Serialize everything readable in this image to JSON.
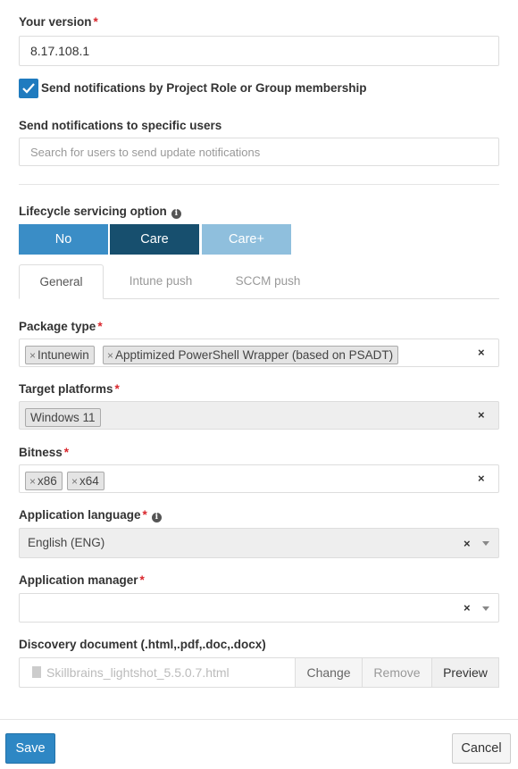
{
  "version": {
    "label": "Your version",
    "value": "8.17.108.1"
  },
  "notify_roles": {
    "label": "Send notifications by Project Role or Group membership",
    "checked": true
  },
  "notify_users": {
    "label": "Send notifications to specific users",
    "placeholder": "Search for users to send update notifications"
  },
  "lifecycle": {
    "label": "Lifecycle servicing option",
    "options": [
      "No",
      "Care",
      "Care+"
    ],
    "selected": "Care",
    "colors": {
      "no": "#3a8dc6",
      "care": "#174f6e",
      "care_plus": "#8fbfdd"
    }
  },
  "tabs": [
    "General",
    "Intune push",
    "SCCM push"
  ],
  "active_tab": "General",
  "package_type": {
    "label": "Package type",
    "tags": [
      "Intunewin",
      "Apptimized PowerShell Wrapper (based on PSADT)"
    ]
  },
  "target_platforms": {
    "label": "Target platforms",
    "tags": [
      "Windows 11"
    ]
  },
  "bitness": {
    "label": "Bitness",
    "tags": [
      "x86",
      "x64"
    ]
  },
  "app_language": {
    "label": "Application language",
    "value": "English (ENG)"
  },
  "app_manager": {
    "label": "Application manager",
    "value": ""
  },
  "discovery": {
    "label": "Discovery document (.html,.pdf,.doc,.docx)",
    "file_name": "Skillbrains_lightshot_5.5.0.7.html",
    "buttons": [
      "Change",
      "Remove",
      "Preview"
    ]
  },
  "footer": {
    "save": "Save",
    "cancel": "Cancel"
  },
  "required_mark": "*",
  "remove_mark": "×",
  "info_mark": "i"
}
